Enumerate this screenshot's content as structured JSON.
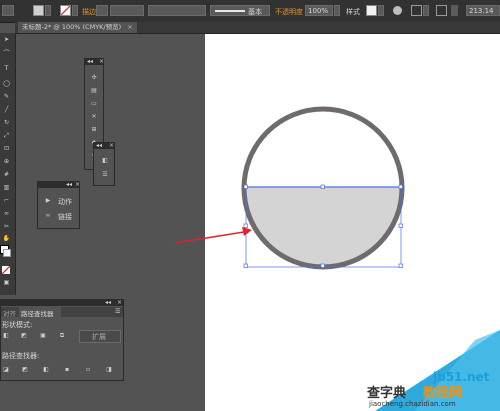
{
  "control_bar": {
    "stroke_label": "描边",
    "stroke_style": "基本",
    "opacity_label": "不透明度",
    "opacity_value": "100%",
    "style_label": "样式",
    "x_value": "213.14"
  },
  "document_tab": {
    "title": "未标题-2* @ 100% (CMYK/预览)",
    "close_glyph": "×"
  },
  "actions_panel": {
    "items": [
      {
        "label": "动作",
        "icon": "play-icon"
      },
      {
        "label": "链接",
        "icon": "link-icon"
      }
    ]
  },
  "pathfinder_panel": {
    "tabs": [
      {
        "label": "对齐"
      },
      {
        "label": "路径查找器"
      }
    ],
    "shape_modes_label": "形状模式:",
    "expand_label": "扩展",
    "pathfinders_label": "路径查找器:"
  },
  "watermark": {
    "site": "jb51.net",
    "brand_left": "查字典",
    "brand_right": "教程网",
    "url": "jiaocheng.chazidian.com"
  },
  "colors": {
    "circle_stroke": "#6e6a6e",
    "fill_gray": "#d4d4d4",
    "selection": "#4b6fe8",
    "arrow": "#e0232b",
    "watermark_blue": "#1aa0d8",
    "brand_orange": "#e8941c"
  }
}
